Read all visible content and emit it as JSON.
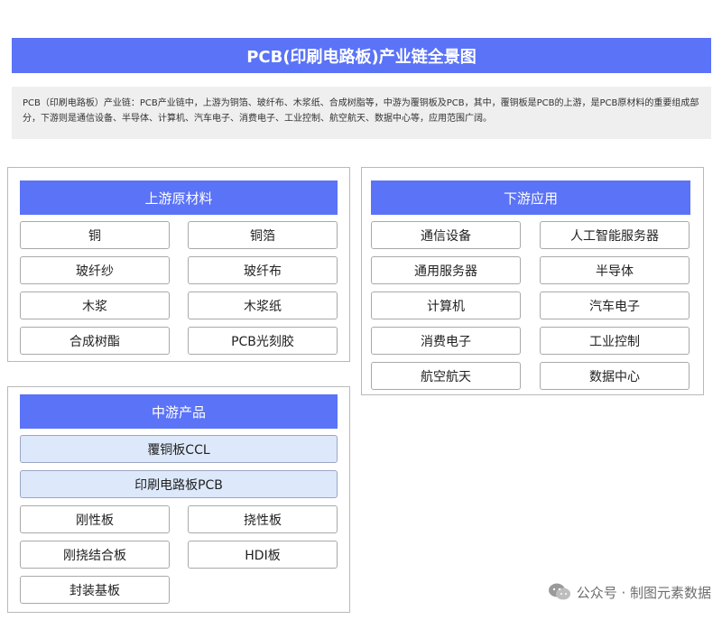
{
  "title": "PCB(印刷电路板)产业链全景图",
  "description": "PCB（印刷电路板）产业链：PCB产业链中，上游为铜箔、玻纤布、木浆纸、合成树脂等，中游为覆铜板及PCB，其中，覆铜板是PCB的上游，是PCB原材料的重要组成部分，下游则是通信设备、半导体、计算机、汽车电子、消费电子、工业控制、航空航天、数据中心等，应用范围广阔。",
  "upstream": {
    "heading": "上游原材料",
    "items": [
      "铜",
      "铜箔",
      "玻纤纱",
      "玻纤布",
      "木浆",
      "木浆纸",
      "合成树酯",
      "PCB光刻胶"
    ]
  },
  "downstream": {
    "heading": "下游应用",
    "items": [
      "通信设备",
      "人工智能服务器",
      "通用服务器",
      "半导体",
      "计算机",
      "汽车电子",
      "消费电子",
      "工业控制",
      "航空航天",
      "数据中心"
    ]
  },
  "midstream": {
    "heading": "中游产品",
    "highlight_items": [
      "覆铜板CCL",
      "印刷电路板PCB"
    ],
    "items": [
      "刚性板",
      "挠性板",
      "刚挠结合板",
      "HDI板",
      "封装基板"
    ]
  },
  "watermark": {
    "text": "公众号 · 制图元素数据",
    "icon": "wechat-icon"
  },
  "colors": {
    "accent": "#5b73f7",
    "highlight": "#dde9fb",
    "panel_border": "#b9b9b9"
  }
}
